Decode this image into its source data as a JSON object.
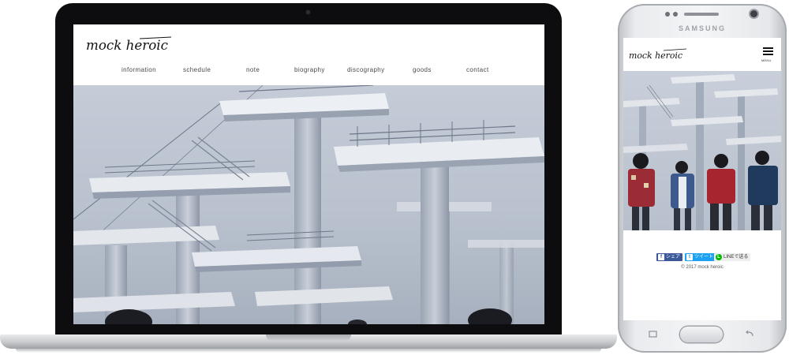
{
  "site": {
    "brand": "mock heroic",
    "desktop_nav": [
      "information",
      "schedule",
      "note",
      "biography",
      "discography",
      "goods",
      "contact"
    ]
  },
  "phone": {
    "brand": "SAMSUNG",
    "menu_label": "MENU",
    "share_buttons": [
      {
        "label": "シェア",
        "icon": "facebook-icon",
        "color": "#3b5998"
      },
      {
        "label": "ツイート",
        "icon": "twitter-icon",
        "color": "#1da1f2"
      },
      {
        "label": "LINEで送る",
        "icon": "line-icon",
        "color": "#00b900"
      }
    ],
    "copyright": "© 2017 mock heroic"
  },
  "colors": {
    "sky": "#c3cbd8",
    "concrete": "#e6e9ee",
    "concrete_shadow": "#8d96a6",
    "text": "#4a4a4a"
  }
}
